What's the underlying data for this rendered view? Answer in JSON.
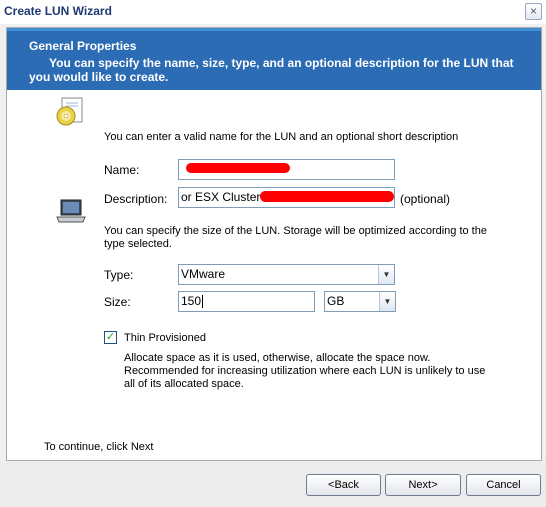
{
  "window": {
    "title": "Create LUN Wizard",
    "close_glyph": "×"
  },
  "header": {
    "title": "General Properties",
    "subtitle": "You can specify the name, size, type, and an optional description for the LUN that you would like to create."
  },
  "name_section": {
    "icon": "cd-disc-icon",
    "intro": "You can enter a valid name for the LUN and an optional short description",
    "name_label": "Name:",
    "name_value": "",
    "description_label": "Description:",
    "description_value": "or ESX Cluster",
    "optional_note": "(optional)"
  },
  "size_section": {
    "icon": "laptop-icon",
    "intro": "You can specify the size of the LUN. Storage will be optimized according to the type selected.",
    "type_label": "Type:",
    "type_value": "VMware",
    "size_label": "Size:",
    "size_value": "150",
    "unit_value": "GB"
  },
  "thin": {
    "checked": true,
    "check_glyph": "✓",
    "label": "Thin Provisioned",
    "description": "Allocate space as it is used, otherwise, allocate the space now. Recommended for increasing utilization where each LUN is unlikely to use all of its allocated space."
  },
  "footer": {
    "hint": "To continue, click Next",
    "back_label": "<Back",
    "next_label": "Next>",
    "cancel_label": "Cancel"
  },
  "colors": {
    "header_band": "#2b6cb4",
    "redaction": "#ff0000",
    "title_text": "#1d3a73"
  }
}
